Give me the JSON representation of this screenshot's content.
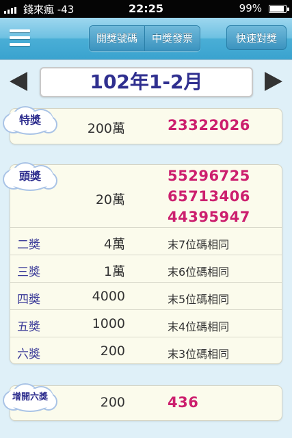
{
  "status": {
    "carrier": "錢來瘋 -43",
    "time": "22:25",
    "battery": "99%"
  },
  "nav": {
    "tabs": [
      "開獎號碼",
      "中獎發票"
    ],
    "quick_check": "快速對獎"
  },
  "period": "102年1-2月",
  "special": {
    "label": "特獎",
    "amount": "200萬",
    "number": "23322026"
  },
  "grand": {
    "label": "頭獎",
    "amount": "20萬",
    "numbers": [
      "55296725",
      "65713406",
      "44395947"
    ]
  },
  "prizes": [
    {
      "label": "二獎",
      "amount": "4萬",
      "rule": "末7位碼相同"
    },
    {
      "label": "三獎",
      "amount": "1萬",
      "rule": "末6位碼相同"
    },
    {
      "label": "四獎",
      "amount": "4000",
      "rule": "末5位碼相同"
    },
    {
      "label": "五獎",
      "amount": "1000",
      "rule": "末4位碼相同"
    },
    {
      "label": "六獎",
      "amount": "200",
      "rule": "末3位碼相同"
    }
  ],
  "extra": {
    "label": "增開六獎",
    "amount": "200",
    "number": "436"
  },
  "colors": {
    "accent_number": "#cc1f6e",
    "label_blue": "#2f2f8f",
    "nav_blue": "#3aa3cf"
  }
}
